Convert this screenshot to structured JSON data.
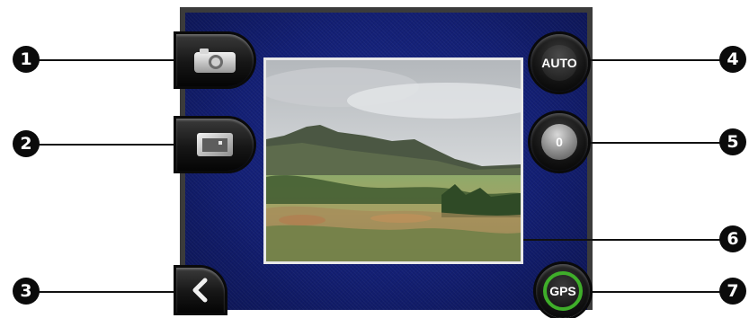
{
  "callouts": [
    "1",
    "2",
    "3",
    "4",
    "5",
    "6",
    "7"
  ],
  "buttons": {
    "exposure_label": "AUTO",
    "brightness_value": "0",
    "gps_label": "GPS"
  },
  "colors": {
    "screen_background": "#131f74",
    "button_dark": "#121212",
    "gps_ring": "#3fae2a",
    "callout": "#0b0b0b"
  },
  "icons": {
    "camera": "camera-icon",
    "gallery": "gallery-icon",
    "back": "chevron-left-icon"
  }
}
